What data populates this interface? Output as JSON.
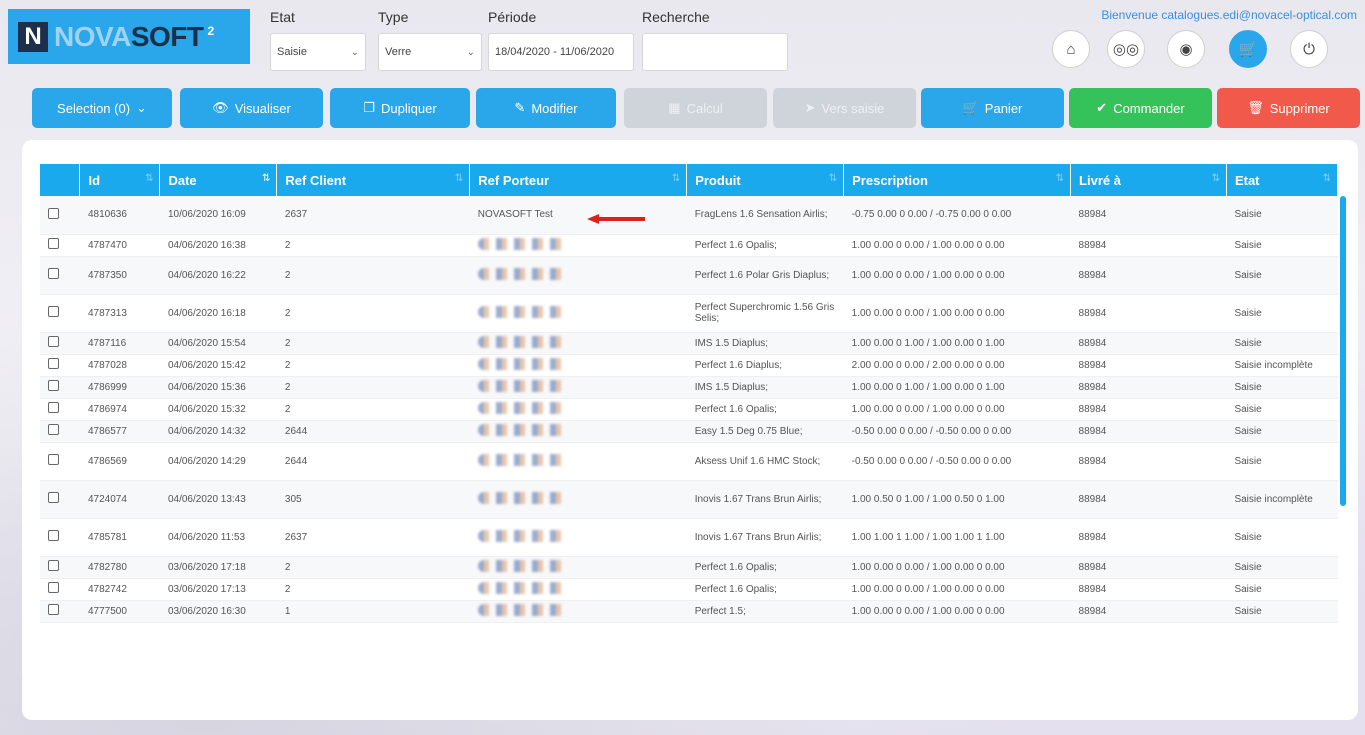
{
  "header": {
    "logo": {
      "n": "N",
      "nova": "NOVA",
      "soft": "SOFT",
      "sup": "2"
    },
    "filters": {
      "etat": {
        "label": "Etat",
        "value": "Saisie"
      },
      "type": {
        "label": "Type",
        "value": "Verre"
      },
      "periode": {
        "label": "Période",
        "value": "18/04/2020 - 11/06/2020"
      },
      "recherche": {
        "label": "Recherche",
        "value": ""
      }
    },
    "welcome": "Bienvenue catalogues.edi@novacel-optical.com",
    "icons": [
      "home-icon",
      "glasses-icon",
      "eye-icon",
      "cart-icon",
      "power-icon"
    ]
  },
  "toolbar": {
    "selection": "Selection (0)",
    "visualiser": "Visualiser",
    "dupliquer": "Dupliquer",
    "modifier": "Modifier",
    "calcul": "Calcul",
    "vers_saisie": "Vers saisie",
    "panier": "Panier",
    "commander": "Commander",
    "supprimer": "Supprimer"
  },
  "colors": {
    "accent": "#2aa6ea",
    "header_row": "#1aa9ec",
    "green": "#35c25a",
    "red": "#f15a4a",
    "arrow": "#e0201b"
  },
  "table": {
    "headers": [
      "Id",
      "Date",
      "Ref Client",
      "Ref Porteur",
      "Produit",
      "Prescription",
      "Livré à",
      "Etat"
    ],
    "rows": [
      {
        "id": "4810636",
        "date": "10/06/2020 16:09",
        "ref_client": "2637",
        "ref_porteur": "NOVASOFT Test",
        "produit": "FragLens 1.6 Sensation Airlis;",
        "prescription": "-0.75 0.00 0 0.00 / -0.75 0.00 0 0.00",
        "livre": "88984",
        "etat": "Saisie",
        "tall": true
      },
      {
        "id": "4787470",
        "date": "04/06/2020 16:38",
        "ref_client": "2",
        "ref_porteur": "",
        "produit": "Perfect 1.6 Opalis;",
        "prescription": "1.00 0.00 0 0.00 / 1.00 0.00 0 0.00",
        "livre": "88984",
        "etat": "Saisie",
        "tall": false
      },
      {
        "id": "4787350",
        "date": "04/06/2020 16:22",
        "ref_client": "2",
        "ref_porteur": "",
        "produit": "Perfect 1.6 Polar Gris Diaplus;",
        "prescription": "1.00 0.00 0 0.00 / 1.00 0.00 0 0.00",
        "livre": "88984",
        "etat": "Saisie",
        "tall": true
      },
      {
        "id": "4787313",
        "date": "04/06/2020 16:18",
        "ref_client": "2",
        "ref_porteur": "",
        "produit": "Perfect Superchromic 1.56 Gris Selis;",
        "prescription": "1.00 0.00 0 0.00 / 1.00 0.00 0 0.00",
        "livre": "88984",
        "etat": "Saisie",
        "tall": true
      },
      {
        "id": "4787116",
        "date": "04/06/2020 15:54",
        "ref_client": "2",
        "ref_porteur": "",
        "produit": "IMS 1.5 Diaplus;",
        "prescription": "1.00 0.00 0 1.00 / 1.00 0.00 0 1.00",
        "livre": "88984",
        "etat": "Saisie",
        "tall": false
      },
      {
        "id": "4787028",
        "date": "04/06/2020 15:42",
        "ref_client": "2",
        "ref_porteur": "",
        "produit": "Perfect 1.6 Diaplus;",
        "prescription": "2.00 0.00 0 0.00 / 2.00 0.00 0 0.00",
        "livre": "88984",
        "etat": "Saisie incomplète",
        "tall": false
      },
      {
        "id": "4786999",
        "date": "04/06/2020 15:36",
        "ref_client": "2",
        "ref_porteur": "",
        "produit": "IMS 1.5 Diaplus;",
        "prescription": "1.00 0.00 0 1.00 / 1.00 0.00 0 1.00",
        "livre": "88984",
        "etat": "Saisie",
        "tall": false
      },
      {
        "id": "4786974",
        "date": "04/06/2020 15:32",
        "ref_client": "2",
        "ref_porteur": "",
        "produit": "Perfect 1.6 Opalis;",
        "prescription": "1.00 0.00 0 0.00 / 1.00 0.00 0 0.00",
        "livre": "88984",
        "etat": "Saisie",
        "tall": false
      },
      {
        "id": "4786577",
        "date": "04/06/2020 14:32",
        "ref_client": "2644",
        "ref_porteur": "",
        "produit": "Easy 1.5 Deg 0.75 Blue;",
        "prescription": "-0.50 0.00 0 0.00 / -0.50 0.00 0 0.00",
        "livre": "88984",
        "etat": "Saisie",
        "tall": false
      },
      {
        "id": "4786569",
        "date": "04/06/2020 14:29",
        "ref_client": "2644",
        "ref_porteur": "",
        "produit": "Aksess Unif 1.6 HMC Stock;",
        "prescription": "-0.50 0.00 0 0.00 / -0.50 0.00 0 0.00",
        "livre": "88984",
        "etat": "Saisie",
        "tall": true
      },
      {
        "id": "4724074",
        "date": "04/06/2020 13:43",
        "ref_client": "305",
        "ref_porteur": "",
        "produit": "Inovis 1.67 Trans Brun Airlis;",
        "prescription": "1.00 0.50 0 1.00 / 1.00 0.50 0 1.00",
        "livre": "88984",
        "etat": "Saisie incomplète",
        "tall": true
      },
      {
        "id": "4785781",
        "date": "04/06/2020 11:53",
        "ref_client": "2637",
        "ref_porteur": "",
        "produit": "Inovis 1.67 Trans Brun Airlis;",
        "prescription": "1.00 1.00 1 1.00 / 1.00 1.00 1 1.00",
        "livre": "88984",
        "etat": "Saisie",
        "tall": true
      },
      {
        "id": "4782780",
        "date": "03/06/2020 17:18",
        "ref_client": "2",
        "ref_porteur": "",
        "produit": "Perfect 1.6 Opalis;",
        "prescription": "1.00 0.00 0 0.00 / 1.00 0.00 0 0.00",
        "livre": "88984",
        "etat": "Saisie",
        "tall": false
      },
      {
        "id": "4782742",
        "date": "03/06/2020 17:13",
        "ref_client": "2",
        "ref_porteur": "",
        "produit": "Perfect 1.6 Opalis;",
        "prescription": "1.00 0.00 0 0.00 / 1.00 0.00 0 0.00",
        "livre": "88984",
        "etat": "Saisie",
        "tall": false
      },
      {
        "id": "4777500",
        "date": "03/06/2020 16:30",
        "ref_client": "1",
        "ref_porteur": "",
        "produit": "Perfect 1.5;",
        "prescription": "1.00 0.00 0 0.00 / 1.00 0.00 0 0.00",
        "livre": "88984",
        "etat": "Saisie",
        "tall": false
      }
    ]
  }
}
